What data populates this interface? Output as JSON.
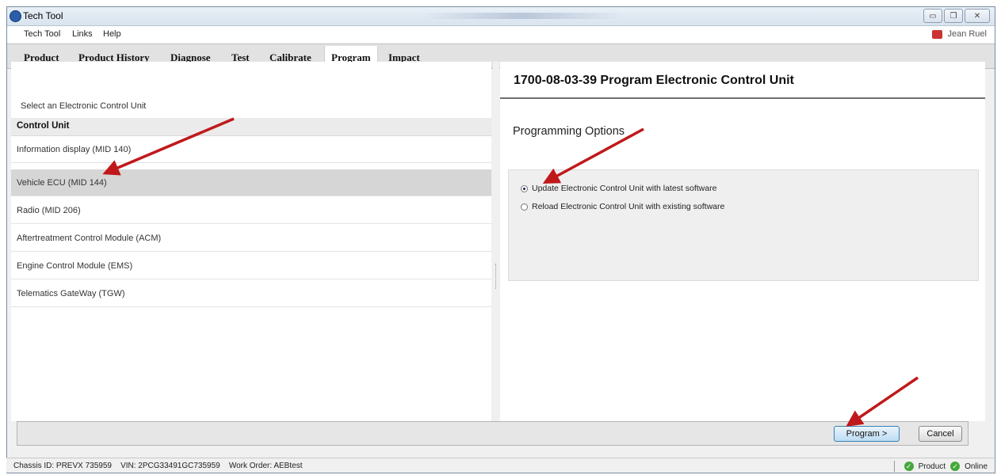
{
  "window": {
    "title": "Tech Tool",
    "minimize_icon": "minimize-icon",
    "restore_icon": "restore-icon",
    "close_icon": "close-icon"
  },
  "menu": {
    "items": [
      "Tech Tool",
      "Links",
      "Help"
    ],
    "user_name": "Jean Ruel"
  },
  "tabs": [
    "Product",
    "Product History",
    "Diagnose",
    "Test",
    "Calibrate",
    "Program",
    "Impact"
  ],
  "active_tab": "Program",
  "left": {
    "header": "Select an Electronic Control Unit",
    "column_header": "Control Unit",
    "control_units": [
      "Information display (MID 140)",
      "Vehicle ECU (MID 144)",
      "Radio (MID 206)",
      "Aftertreatment Control Module (ACM)",
      "Engine Control Module (EMS)",
      "Telematics GateWay (TGW)"
    ],
    "selected_index": 1
  },
  "right": {
    "title": "1700-08-03-39 Program Electronic Control Unit",
    "options_title": "Programming Options",
    "options": [
      "Update Electronic Control Unit with latest software",
      "Reload Electronic Control Unit with existing software"
    ],
    "selected_option": 0
  },
  "buttons": {
    "program": "Program >",
    "cancel": "Cancel"
  },
  "status": {
    "chassis": "Chassis ID: PREVX 735959",
    "vin": "VIN: 2PCG33491GC735959",
    "work_order": "Work Order: AEBtest",
    "product": "Product",
    "online": "Online"
  },
  "colors": {
    "annotation_arrow": "#c0191b",
    "status_ok": "#44a83a"
  }
}
